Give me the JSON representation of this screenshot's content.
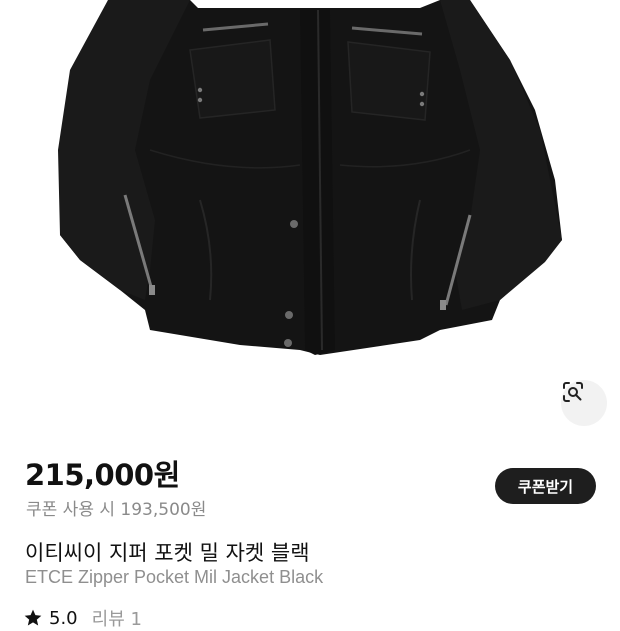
{
  "product": {
    "image_subject": "black zipper pocket military jacket",
    "price": "215,000원",
    "coupon_price": "쿠폰 사용 시 193,500원",
    "coupon_button_label": "쿠폰받기",
    "name_ko": "이티씨이 지퍼 포켓 밀 자켓 블랙",
    "name_en": "ETCE Zipper Pocket Mil Jacket Black",
    "rating": "5.0",
    "reviews": "리뷰 1"
  },
  "icons": {
    "lens": "lens-search-icon",
    "star": "star-icon"
  },
  "colors": {
    "jacket": "#151515",
    "button_bg": "#1e1e1e",
    "secondary_text": "#8a8a8a"
  }
}
